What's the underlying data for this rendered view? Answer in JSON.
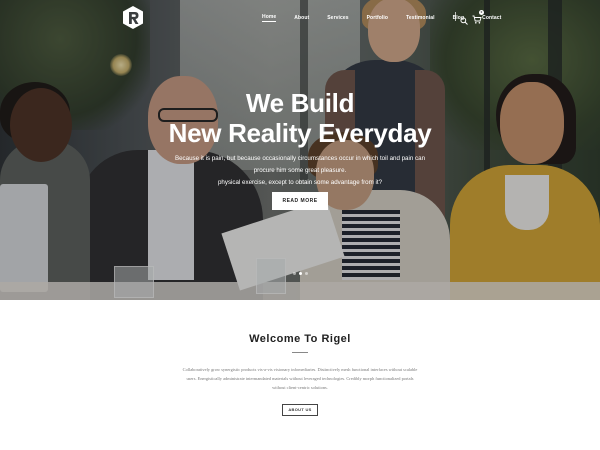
{
  "nav": {
    "items": [
      {
        "label": "Home",
        "active": true
      },
      {
        "label": "About",
        "active": false
      },
      {
        "label": "Services",
        "active": false
      },
      {
        "label": "Portfolio",
        "active": false
      },
      {
        "label": "Testimonial",
        "active": false
      },
      {
        "label": "Blog",
        "active": false
      },
      {
        "label": "Contact",
        "active": false
      }
    ],
    "cart_count": "0",
    "logo_icon": "logo-r-icon",
    "search_icon": "search-icon",
    "cart_icon": "cart-icon"
  },
  "hero": {
    "title_line1": "We Build",
    "title_line2": "New Reality Everyday",
    "subtitle_line1": "Because it is pain, but because occasionally circumstances occur in which toil and pain can procure him some great pleasure.",
    "subtitle_line2": "physical exercise, except to obtain some advantage from it?",
    "button_label": "READ MORE",
    "slide_count": 3,
    "active_slide": 1
  },
  "welcome": {
    "title": "Welcome To Rigel",
    "body": "Collaboratively grow synergistic products vis-a-vis visionary infomediaries. Distinctively mesh functional interfaces without scalable users. Energistically administrate intermandated materials without leveraged technologies. Credibly morph functionalized portals without client-centric solutions.",
    "button_label": "ABOUT US"
  },
  "colors": {
    "hero_overlay": "#141414",
    "accent_text": "#ffffff",
    "heading": "#222222",
    "body_text": "#777777"
  }
}
